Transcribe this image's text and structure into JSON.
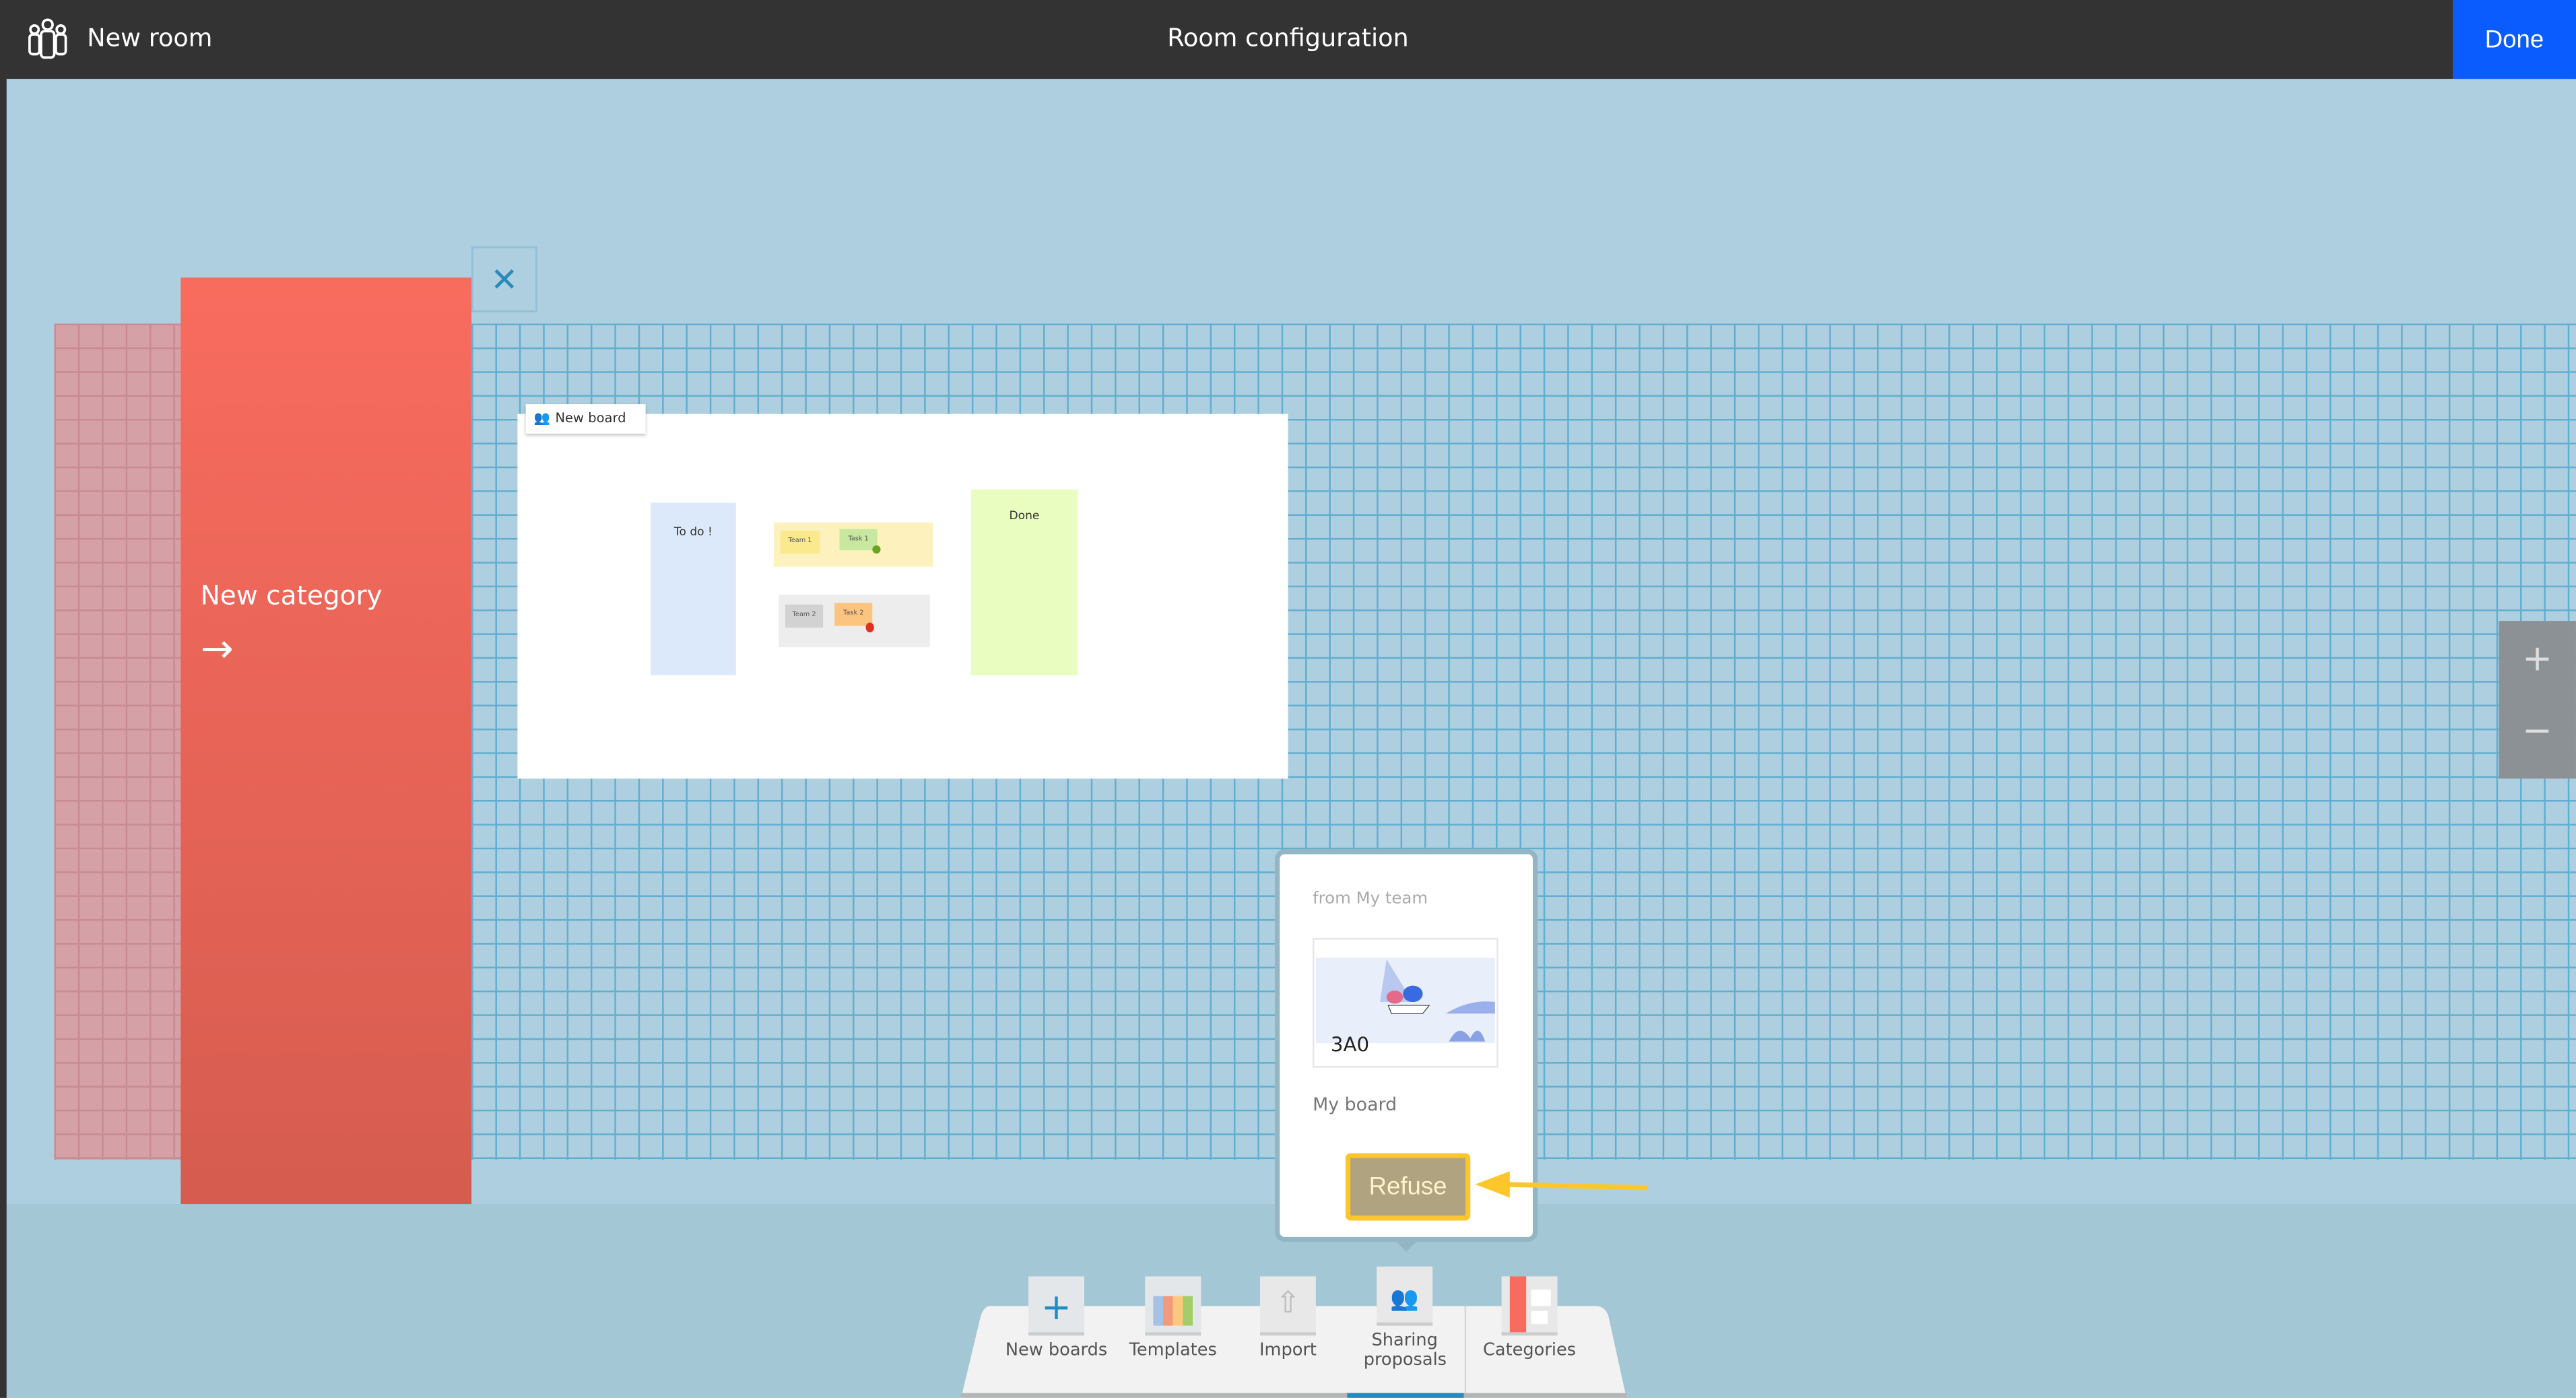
{
  "header": {
    "room_name": "New room",
    "title": "Room configuration",
    "done_label": "Done",
    "room_icon": "people-group-icon"
  },
  "category": {
    "label": "New category",
    "arrow": "→"
  },
  "close_symbol": "✕",
  "board": {
    "title": "New board",
    "columns": {
      "todo": "To do !",
      "done": "Done"
    },
    "cards": {
      "team1": "Team 1",
      "task1": "Task 1",
      "team2": "Team 2",
      "task2": "Task 2"
    }
  },
  "zoom": {
    "plus": "+",
    "minus": "−"
  },
  "popup": {
    "from": "from My team",
    "thumbnail_caption": "3A0",
    "board_name": "My board",
    "refuse_label": "Refuse"
  },
  "toolbar": {
    "items": [
      {
        "label": "New boards",
        "icon": "plus-icon"
      },
      {
        "label": "Templates",
        "icon": "template-grid-icon"
      },
      {
        "label": "Import",
        "icon": "upload-icon"
      },
      {
        "label": "Sharing proposals",
        "icon": "sharing-people-icon",
        "active": true
      },
      {
        "label": "Categories",
        "icon": "categories-icon"
      }
    ]
  },
  "colors": {
    "header": "#333333",
    "done": "#0b5cff",
    "canvas": "#aecfdf",
    "category": "#f86c5e",
    "refuse": "#b0a37f",
    "highlight": "#fcc62c",
    "active_tab": "#228cbf"
  }
}
